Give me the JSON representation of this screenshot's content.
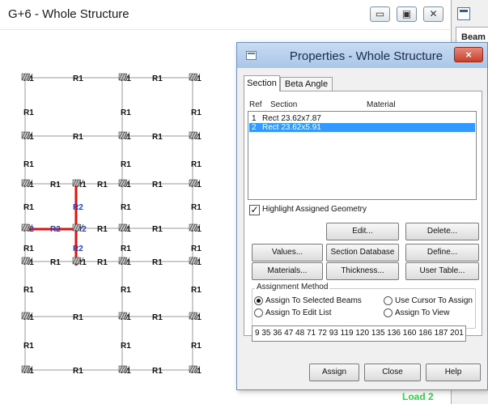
{
  "window": {
    "title": "G+6 - Whole Structure",
    "minimize_glyph": "▭",
    "restore_glyph": "▣",
    "close_glyph": "✕"
  },
  "right_panel": {
    "tab_label": "Beam",
    "status_text": "Load 2"
  },
  "structure": {
    "label_color": "#111111",
    "highlight_label_color": "#1a3fd8",
    "highlight_member_color": "#e01010",
    "rows": [
      {
        "left": [
          "R1",
          "R1"
        ],
        "mid": [
          "R1",
          "R1"
        ],
        "right": [
          "R1"
        ],
        "top": true
      },
      {
        "left": [
          "R1"
        ],
        "mid": [
          "R1"
        ],
        "right": [
          "R1"
        ]
      },
      {
        "left": [
          "R1",
          "R1"
        ],
        "mid": [
          "R1",
          "R1"
        ],
        "right": [
          "R1"
        ],
        "support": true
      },
      {
        "left": [
          "R1"
        ],
        "mid": [
          "R1"
        ],
        "right": [
          "R1"
        ]
      },
      {
        "left": [
          "R1",
          "R1",
          "R1",
          "R1"
        ],
        "mid": [
          "R1",
          "R1"
        ],
        "right": [
          "R1"
        ],
        "support": true
      },
      {
        "left": [
          "R1",
          "R2"
        ],
        "mid": [
          "R1"
        ],
        "right": [
          "R1"
        ]
      },
      {
        "left": [
          "R2",
          "R2",
          "R2",
          "R1"
        ],
        "mid": [
          "R1",
          "R1"
        ],
        "right": [
          "R1"
        ],
        "support": true
      },
      {
        "left": [
          "R1",
          "R2"
        ],
        "mid": [
          "R1"
        ],
        "right": [
          "R1"
        ]
      },
      {
        "left": [
          "R1",
          "R1",
          "R1",
          "R1"
        ],
        "mid": [
          "R1",
          "R1"
        ],
        "right": [
          "R1"
        ],
        "support": true
      },
      {
        "left": [
          "R1"
        ],
        "mid": [
          "R1"
        ],
        "right": [
          "R1"
        ]
      },
      {
        "left": [
          "R1",
          "R1"
        ],
        "mid": [
          "R1",
          "R1"
        ],
        "right": [
          "R1"
        ],
        "support": true
      },
      {
        "left": [
          "R1"
        ],
        "mid": [
          "R1"
        ],
        "right": [
          "R1"
        ]
      },
      {
        "left": [
          "R1",
          "R1"
        ],
        "mid": [
          "R1",
          "R1"
        ],
        "right": [
          "R1"
        ],
        "support": true
      }
    ]
  },
  "dialog": {
    "title": "Properties - Whole Structure",
    "close_glyph": "×",
    "tabs": [
      "Section",
      "Beta Angle"
    ],
    "active_tab": "Section",
    "columns": {
      "ref": "Ref",
      "section": "Section",
      "material": "Material"
    },
    "sections": [
      {
        "ref": "1",
        "section": "Rect 23.62x7.87",
        "selected": false
      },
      {
        "ref": "2",
        "section": "Rect 23.62x5.91",
        "selected": true
      }
    ],
    "highlight_checked": true,
    "highlight_label": "Highlight Assigned Geometry",
    "buttons": {
      "edit": "Edit...",
      "delete": "Delete...",
      "values": "Values...",
      "section_database": "Section Database",
      "define": "Define...",
      "materials": "Materials...",
      "thickness": "Thickness...",
      "user_table": "User Table..."
    },
    "assignment": {
      "legend": "Assignment Method",
      "options": [
        {
          "label": "Assign To Selected Beams",
          "checked": true
        },
        {
          "label": "Use Cursor To Assign",
          "checked": false
        },
        {
          "label": "Assign To Edit List",
          "checked": false
        },
        {
          "label": "Assign To View",
          "checked": false
        }
      ],
      "edit_list": "9 35 36 47 48 71 72 93 119 120 135 136 160 186 187 201"
    },
    "footer": {
      "assign": "Assign",
      "close": "Close",
      "help": "Help"
    }
  }
}
